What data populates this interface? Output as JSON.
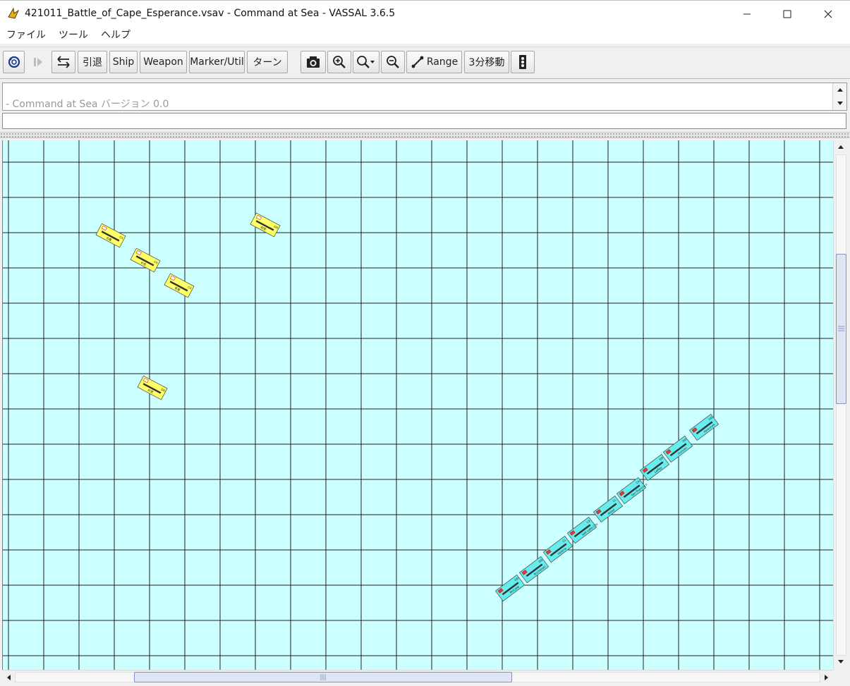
{
  "window": {
    "title": "421011_Battle_of_Cape_Esperance.vsav - Command at Sea - VASSAL 3.6.5"
  },
  "menu": {
    "items": [
      {
        "label": "ファイル"
      },
      {
        "label": "ツール"
      },
      {
        "label": "ヘルプ"
      }
    ]
  },
  "toolbar": {
    "retreat_label": "引退",
    "ship_label": "Ship",
    "weapon_label": "Weapon",
    "marker_label": "Marker/Util",
    "turn_label": "ターン",
    "range_label": "Range",
    "move3_label": "3分移動"
  },
  "chat": {
    "message": "- Command at Sea バージョン 0.0",
    "input_value": ""
  },
  "colors": {
    "sea": "#ccffff",
    "grid": "#202020",
    "japanese_counter": "#ffff66",
    "us_counter": "#66eeee"
  },
  "map": {
    "japanese_ships": [
      {
        "name": "古鷹",
        "type": "CA"
      },
      {
        "name": "衣笠",
        "type": "CA"
      },
      {
        "name": "青葉",
        "type": "CA"
      },
      {
        "name": "初雪",
        "type": "DD"
      },
      {
        "name": "吹雪",
        "type": "DD"
      }
    ],
    "us_ships": [
      {
        "name": "McCalla",
        "type": "DD"
      },
      {
        "name": "Buchanan",
        "type": "DD"
      },
      {
        "name": "Helena",
        "type": "CL"
      },
      {
        "name": "Salt Lake City",
        "type": "CA"
      },
      {
        "name": "Boise",
        "type": "CL"
      },
      {
        "name": "San Francisco",
        "type": "CA"
      },
      {
        "name": "Laffey",
        "type": "DD"
      },
      {
        "name": "Duncan",
        "type": "DD"
      },
      {
        "name": "Farenholt",
        "type": "DD"
      }
    ]
  }
}
